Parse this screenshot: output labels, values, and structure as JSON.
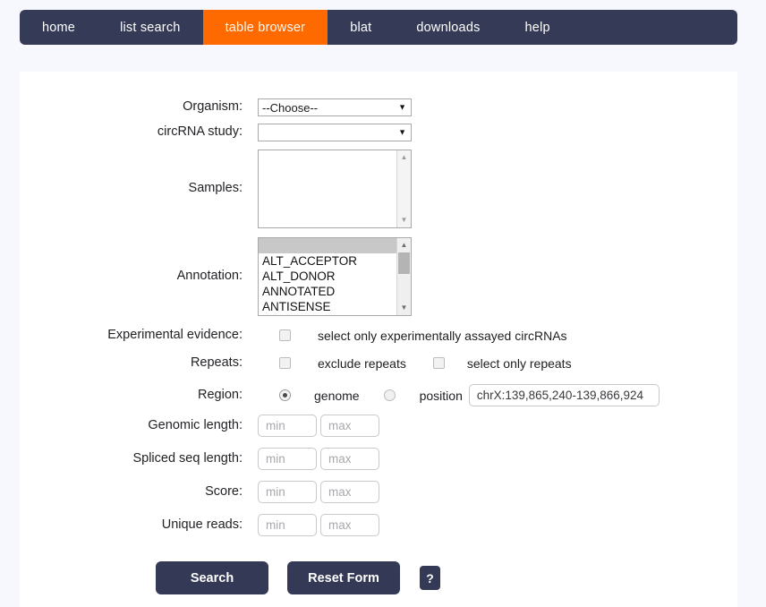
{
  "nav": {
    "active_color": "#ff6a00",
    "bar_color": "#353a57",
    "items": [
      {
        "label": "home",
        "active": false
      },
      {
        "label": "list search",
        "active": false
      },
      {
        "label": "table browser",
        "active": true
      },
      {
        "label": "blat",
        "active": false
      },
      {
        "label": "downloads",
        "active": false
      },
      {
        "label": "help",
        "active": false
      }
    ]
  },
  "form": {
    "organism": {
      "label": "Organism:",
      "value": "--Choose--",
      "caret": "▼"
    },
    "circrna_study": {
      "label": "circRNA study:",
      "value": "",
      "caret": "▼"
    },
    "samples": {
      "label": "Samples:",
      "options": [],
      "scroll_up": "▲",
      "scroll_down": "▼"
    },
    "annotation": {
      "label": "Annotation:",
      "options": [
        "",
        "ALT_ACCEPTOR",
        "ALT_DONOR",
        "ANNOTATED",
        "ANTISENSE"
      ],
      "selected_index": 0,
      "scroll_up": "▲",
      "scroll_down": "▼"
    },
    "experimental_evidence": {
      "label": "Experimental evidence:",
      "checkbox_label": "select only experimentally assayed circRNAs",
      "checked": false
    },
    "repeats": {
      "label": "Repeats:",
      "exclude_label": "exclude repeats",
      "exclude_checked": false,
      "only_label": "select only repeats",
      "only_checked": false
    },
    "region": {
      "label": "Region:",
      "genome_label": "genome",
      "genome_selected": true,
      "position_label": "position",
      "position_selected": false,
      "position_value": "chrX:139,865,240-139,866,924"
    },
    "genomic_length": {
      "label": "Genomic length:",
      "min_placeholder": "min",
      "max_placeholder": "max",
      "min_value": "",
      "max_value": ""
    },
    "spliced_seq_length": {
      "label": "Spliced seq length:",
      "min_placeholder": "min",
      "max_placeholder": "max",
      "min_value": "",
      "max_value": ""
    },
    "score": {
      "label": "Score:",
      "min_placeholder": "min",
      "max_placeholder": "max",
      "min_value": "",
      "max_value": ""
    },
    "unique_reads": {
      "label": "Unique reads:",
      "min_placeholder": "min",
      "max_placeholder": "max",
      "min_value": "",
      "max_value": ""
    }
  },
  "actions": {
    "search_label": "Search",
    "reset_label": "Reset Form",
    "help_label": "?",
    "button_color": "#343a56"
  }
}
